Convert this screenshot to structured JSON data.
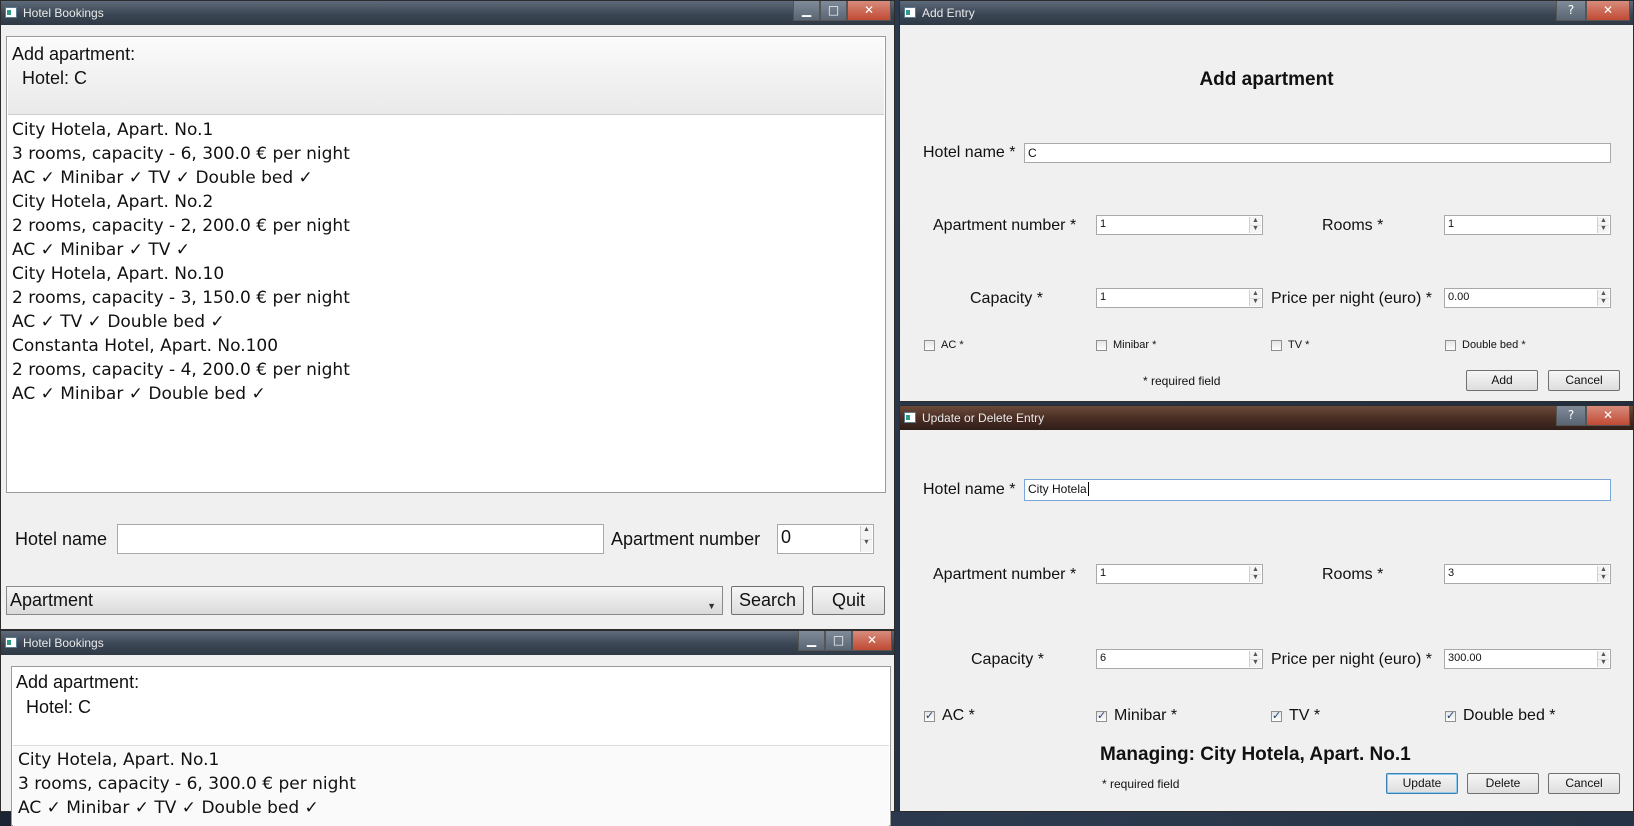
{
  "main_window": {
    "title": "Hotel Bookings",
    "header_line1": "Add apartment:",
    "header_line2": "  Hotel: C",
    "entries": [
      "City Hotela, Apart. No.1",
      "3 rooms, capacity - 6, 300.0 € per night",
      "AC ✓ Minibar ✓ TV ✓ Double bed ✓",
      "City Hotela, Apart. No.2",
      "2 rooms, capacity - 2, 200.0 € per night",
      "AC ✓ Minibar ✓ TV ✓",
      "City Hotela, Apart. No.10",
      "2 rooms, capacity - 3, 150.0 € per night",
      "AC ✓ TV ✓ Double bed ✓",
      "Constanta Hotel, Apart. No.100",
      "2 rooms, capacity - 4, 200.0 € per night",
      "AC ✓ Minibar ✓ Double bed ✓"
    ],
    "hotel_name_label": "Hotel name",
    "hotel_name_value": "",
    "apartment_number_label": "Apartment number",
    "apartment_number_value": "0",
    "type_combo_value": "Apartment",
    "search_label": "Search",
    "quit_label": "Quit",
    "btn_min": "▁",
    "btn_max": "□",
    "btn_close": "✕"
  },
  "second_window": {
    "title": "Hotel Bookings",
    "header_line1": "Add apartment:",
    "header_line2": "  Hotel: C",
    "entries": [
      "City Hotela, Apart. No.1",
      "3 rooms, capacity - 6, 300.0 € per night",
      "AC ✓ Minibar ✓ TV ✓ Double bed ✓"
    ]
  },
  "add_dialog": {
    "title": "Add Entry",
    "heading": "Add apartment",
    "hotel_name_label": "Hotel name *",
    "hotel_name_value": "C",
    "apartment_number_label": "Apartment number *",
    "apartment_number_value": "1",
    "rooms_label": "Rooms *",
    "rooms_value": "1",
    "capacity_label": "Capacity *",
    "capacity_value": "1",
    "price_label": "Price per night (euro) *",
    "price_value": "0.00",
    "ac_label": "AC *",
    "minibar_label": "Minibar *",
    "tv_label": "TV *",
    "doublebed_label": "Double bed *",
    "ac_checked": false,
    "minibar_checked": false,
    "tv_checked": false,
    "doublebed_checked": false,
    "required_note": "* required field",
    "add_label": "Add",
    "cancel_label": "Cancel",
    "btn_help": "?",
    "btn_close": "✕"
  },
  "update_dialog": {
    "title": "Update or Delete Entry",
    "hotel_name_label": "Hotel name *",
    "hotel_name_value": "City Hotela",
    "apartment_number_label": "Apartment number *",
    "apartment_number_value": "1",
    "rooms_label": "Rooms *",
    "rooms_value": "3",
    "capacity_label": "Capacity *",
    "capacity_value": "6",
    "price_label": "Price per night (euro) *",
    "price_value": "300.00",
    "ac_label": "AC *",
    "minibar_label": "Minibar *",
    "tv_label": "TV *",
    "doublebed_label": "Double bed *",
    "ac_checked": true,
    "minibar_checked": true,
    "tv_checked": true,
    "doublebed_checked": true,
    "managing_text": "Managing: City Hotela, Apart. No.1",
    "required_note": "* required field",
    "update_label": "Update",
    "delete_label": "Delete",
    "cancel_label": "Cancel",
    "btn_help": "?",
    "btn_close": "✕"
  }
}
